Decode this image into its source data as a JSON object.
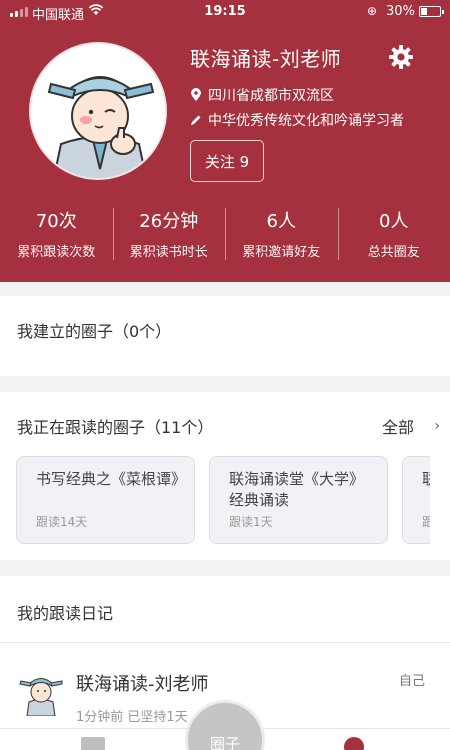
{
  "status_bar": {
    "carrier": "中国联通",
    "time": "19:15",
    "battery": "30%"
  },
  "profile": {
    "name": "联海诵读-刘老师",
    "location": "四川省成都市双流区",
    "bio": "中华优秀传统文化和吟诵学习者",
    "follow_label": "关注 9"
  },
  "stats": [
    {
      "value": "70次",
      "label": "累积跟读次数"
    },
    {
      "value": "26分钟",
      "label": "累积读书时长"
    },
    {
      "value": "6人",
      "label": "累积邀请好友"
    },
    {
      "value": "0人",
      "label": "总共圈友"
    }
  ],
  "created_circles": {
    "title": "我建立的圈子（0个）"
  },
  "following_circles": {
    "title": "我正在跟读的圈子（11个）",
    "see_all": "全部",
    "cards": [
      {
        "title": "书写经典之《菜根谭》",
        "sub": "跟读14天"
      },
      {
        "title": "联海诵读堂《大学》经典诵读",
        "sub": "跟读1天"
      },
      {
        "title": "联",
        "sub": "跟"
      }
    ]
  },
  "diary": {
    "title": "我的跟读日记",
    "post": {
      "name": "联海诵读-刘老师",
      "tag": "自己",
      "meta": "1分钟前 已坚持1天"
    }
  },
  "tabbar": {
    "center_label": "圈子"
  },
  "colors": {
    "brand": "#a4313d"
  }
}
